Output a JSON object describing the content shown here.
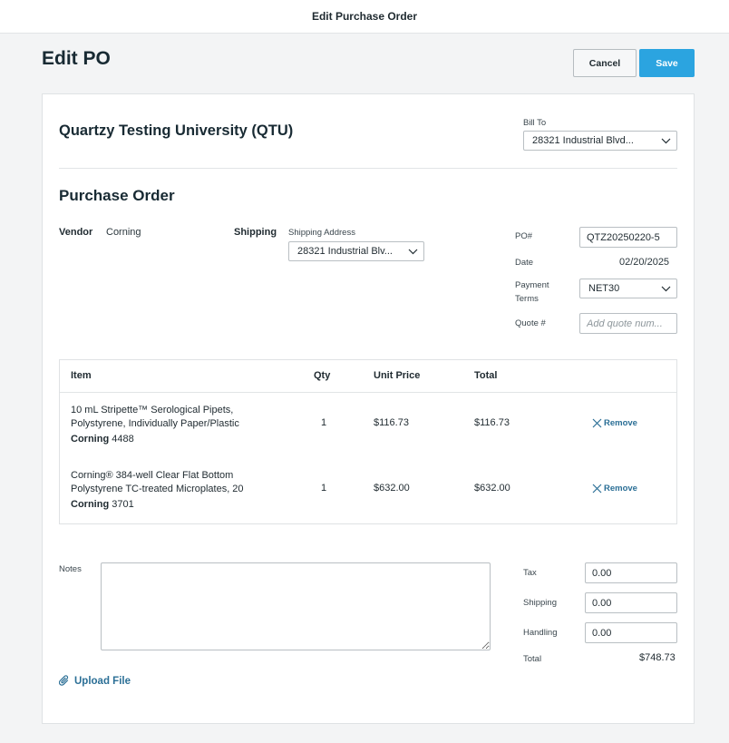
{
  "window": {
    "title": "Edit Purchase Order"
  },
  "header": {
    "title": "Edit PO",
    "cancel_label": "Cancel",
    "save_label": "Save"
  },
  "organization": {
    "name": "Quartzy Testing University (QTU)",
    "bill_to_label": "Bill To",
    "bill_to_value": "28321 Industrial Blvd..."
  },
  "purchase_order": {
    "section_title": "Purchase Order",
    "vendor_label": "Vendor",
    "vendor_value": "Corning",
    "shipping_label": "Shipping",
    "shipping_address_label": "Shipping Address",
    "shipping_address_value": "28321 Industrial Blv...",
    "po_number_label": "PO#",
    "po_number_value": "QTZ20250220-5",
    "date_label": "Date",
    "date_value": "02/20/2025",
    "payment_terms_label_line1": "Payment",
    "payment_terms_label_line2": "Terms",
    "payment_terms_value": "NET30",
    "quote_label": "Quote #",
    "quote_placeholder": "Add quote num...",
    "quote_value": ""
  },
  "items_table": {
    "headers": {
      "item": "Item",
      "qty": "Qty",
      "unit_price": "Unit Price",
      "total": "Total"
    },
    "remove_label": "Remove",
    "rows": [
      {
        "name_line1": "10 mL Stripette™ Serological Pipets,",
        "name_line2": "Polystyrene, Individually Paper/Plastic",
        "vendor": "Corning",
        "catalog": "4488",
        "qty": "1",
        "unit_price": "$116.73",
        "total": "$116.73"
      },
      {
        "name_line1": "Corning® 384-well Clear Flat Bottom",
        "name_line2": "Polystyrene TC-treated Microplates, 20",
        "vendor": "Corning",
        "catalog": "3701",
        "qty": "1",
        "unit_price": "$632.00",
        "total": "$632.00"
      }
    ]
  },
  "notes": {
    "label": "Notes",
    "value": ""
  },
  "upload": {
    "label": "Upload File"
  },
  "totals": {
    "tax_label": "Tax",
    "tax_value": "0.00",
    "shipping_label": "Shipping",
    "shipping_value": "0.00",
    "handling_label": "Handling",
    "handling_value": "0.00",
    "total_label": "Total",
    "total_value": "$748.73"
  },
  "colors": {
    "accent": "#2ba4e0",
    "link": "#2b6f96",
    "background": "#f3f4f5"
  }
}
